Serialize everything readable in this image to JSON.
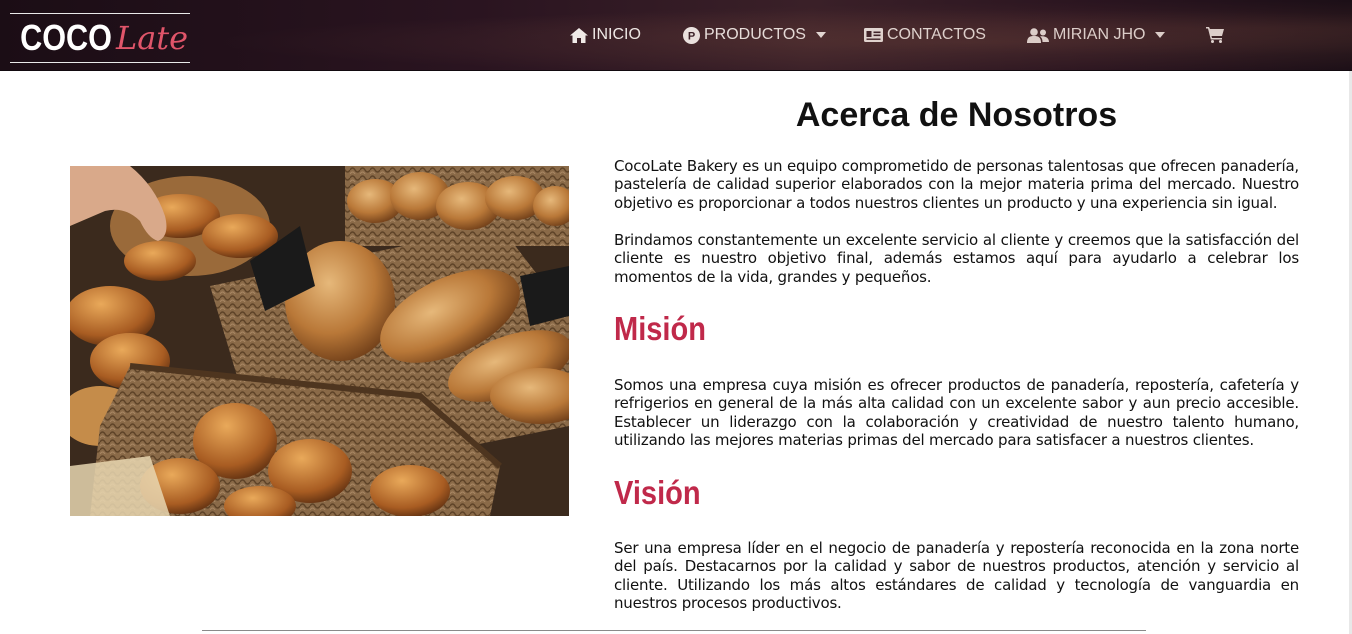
{
  "brand": {
    "logo_left": "COCO",
    "logo_right": "Late"
  },
  "nav": {
    "inicio": "INICIO",
    "productos": "PRODUCTOS",
    "contactos": "CONTACTOS",
    "user": "MIRIAN JHO"
  },
  "about": {
    "title": "Acerca de Nosotros",
    "p1": "CocoLate Bakery es un equipo comprometido de personas talentosas que ofrecen panadería, pastelería de calidad superior elaborados con la mejor materia prima del mercado. Nuestro objetivo es proporcionar a todos nuestros clientes un producto y una experiencia sin igual.",
    "p2": "Brindamos constantemente un excelente servicio al cliente y creemos que la satisfacción del cliente es nuestro objetivo final, además estamos aquí para ayudarlo a celebrar los momentos de la vida, grandes y pequeños."
  },
  "mision": {
    "title": "Misión",
    "text": "Somos una empresa cuya misión es ofrecer productos de panadería, repostería, cafetería y refrigerios en general de la más alta calidad con un excelente sabor y aun precio accesible. Establecer un liderazgo con la colaboración y creatividad de nuestro talento humano, utilizando las mejores materias primas del mercado para satisfacer a nuestros clientes."
  },
  "vision": {
    "title": "Visión",
    "text": "Ser una empresa líder en el negocio de panadería y repostería reconocida en la zona norte del país. Destacarnos por la calidad y sabor de nuestros productos, atención y servicio al cliente. Utilizando los más altos estándares de calidad y tecnología de vanguardia en nuestros procesos productivos."
  },
  "colors": {
    "accent": "#c0294a",
    "logo_accent": "#e0556a",
    "navbar": "#2a1420"
  },
  "icons": [
    "home-icon",
    "productos-p-icon",
    "id-card-icon",
    "users-icon",
    "cart-icon",
    "caret-down-icon"
  ]
}
